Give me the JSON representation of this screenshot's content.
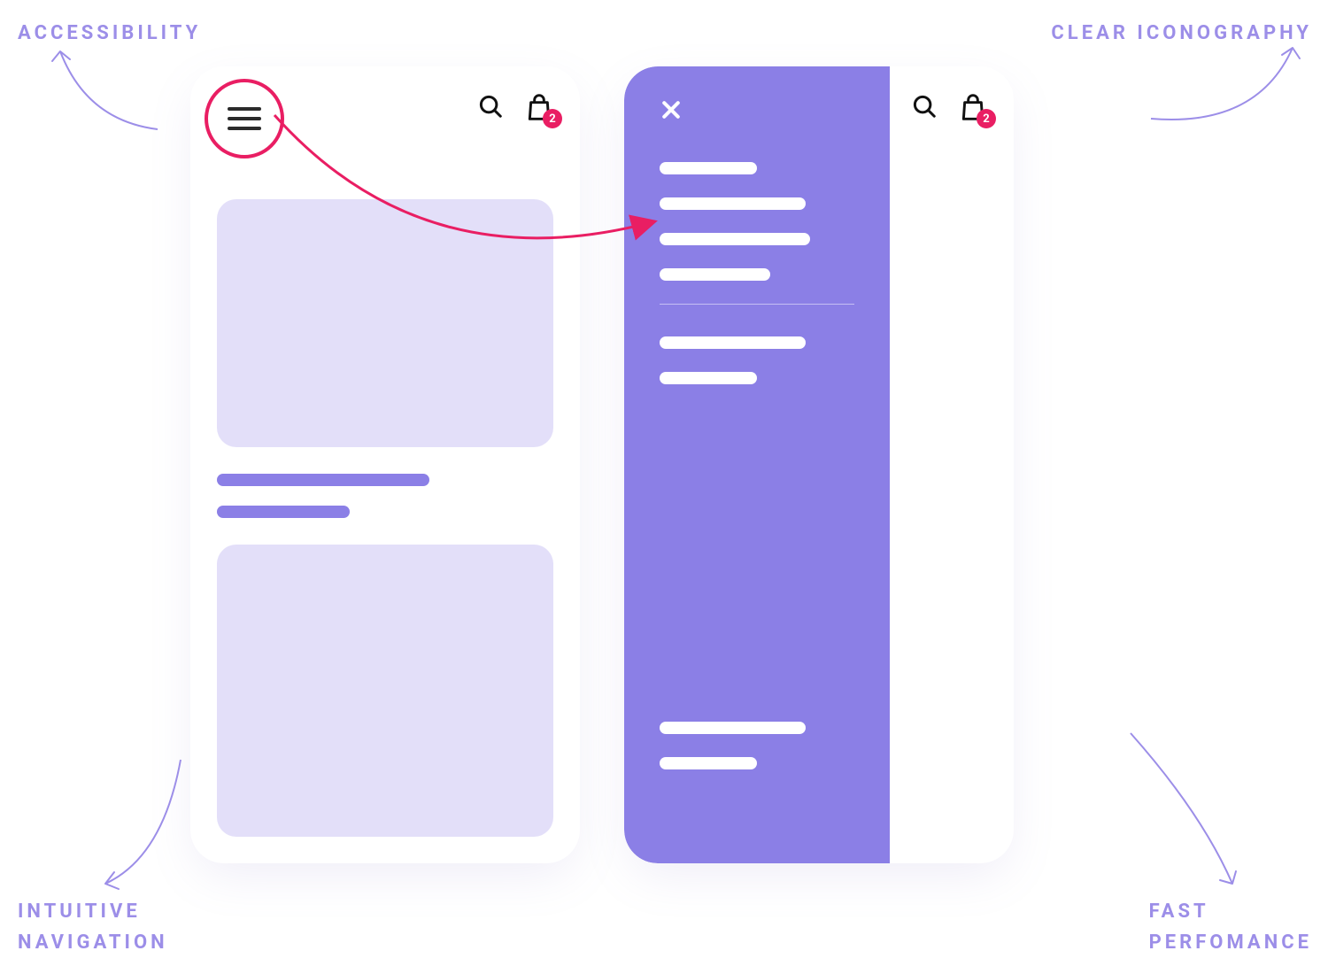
{
  "labels": {
    "top_left": "ACCESSIBILITY",
    "top_right": "CLEAR ICONOGRAPHY",
    "bottom_left_line1": "INTUITIVE",
    "bottom_left_line2": "NAVIGATION",
    "bottom_right_line1": "FAST",
    "bottom_right_line2": "PERFOMANCE"
  },
  "bag_badge": "2",
  "drawer_item_widths": [
    110,
    165,
    170,
    125
  ],
  "drawer_group2_widths": [
    165,
    110
  ],
  "drawer_group3_widths": [
    165,
    110
  ],
  "colors": {
    "purple": "#8B7FE6",
    "purple_light": "#E3DFF9",
    "pink": "#E91E63"
  }
}
